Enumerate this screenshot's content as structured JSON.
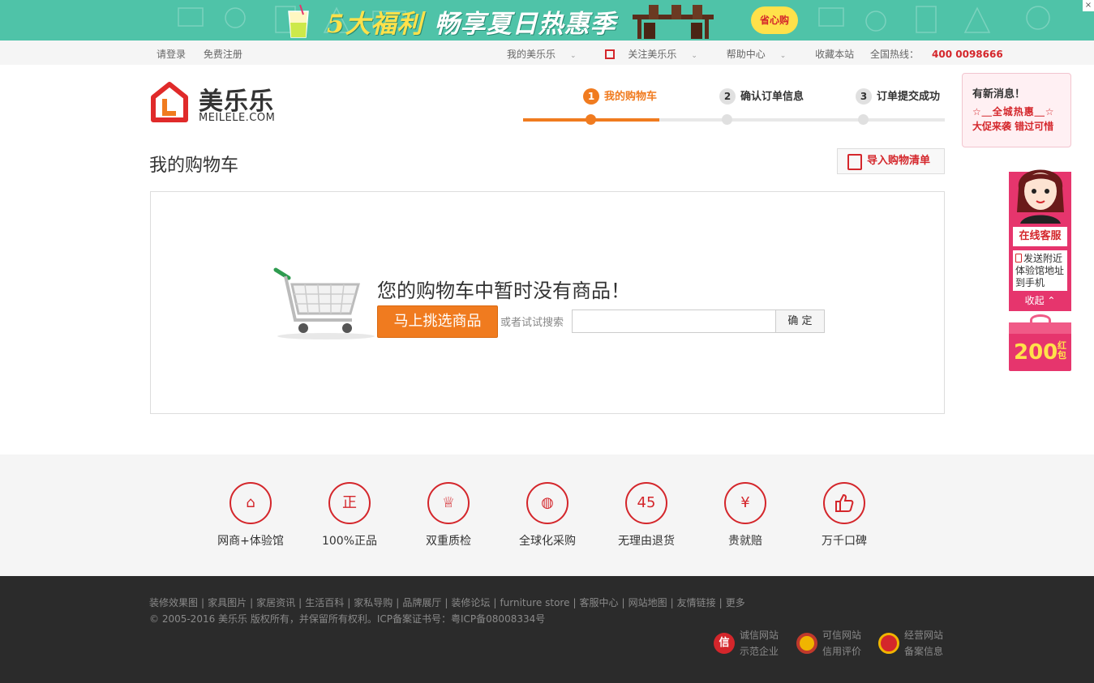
{
  "banner": {
    "title_yellow": "5大福利",
    "title_white": "畅享夏日热惠季",
    "badge": "省心购",
    "close": "×"
  },
  "topnav": {
    "login": "请登录",
    "register": "免费注册",
    "my_account": "我的美乐乐",
    "follow": "关注美乐乐",
    "help": "帮助中心",
    "bookmark": "收藏本站",
    "hotline_label": "全国热线：",
    "hotline_number": "400 0098666"
  },
  "logo": {
    "cn": "美乐乐",
    "en": "MEILELE.COM"
  },
  "steps": [
    {
      "num": "1",
      "label": "我的购物车",
      "active": true
    },
    {
      "num": "2",
      "label": "确认订单信息",
      "active": false
    },
    {
      "num": "3",
      "label": "订单提交成功",
      "active": false
    }
  ],
  "page": {
    "title": "我的购物车",
    "import_label": "导入购物清单"
  },
  "cart": {
    "empty_message": "您的购物车中暂时没有商品！",
    "shop_button": "马上挑选商品",
    "or_search": "或者试试搜索",
    "search_value": "",
    "confirm": "确 定"
  },
  "features": [
    {
      "label": "网商+体验馆",
      "icon": "store-icon",
      "glyph": "⌂"
    },
    {
      "label": "100%正品",
      "icon": "shield-icon",
      "glyph": "正"
    },
    {
      "label": "双重质检",
      "icon": "trophy-icon",
      "glyph": "♕"
    },
    {
      "label": "全球化采购",
      "icon": "globe-icon",
      "glyph": "◍"
    },
    {
      "label": "无理由退货",
      "icon": "return-45-icon",
      "glyph": "45"
    },
    {
      "label": "贵就赔",
      "icon": "yuan-icon",
      "glyph": "¥"
    },
    {
      "label": "万千口碑",
      "icon": "thumbs-up-icon",
      "glyph": "👍"
    }
  ],
  "footer": {
    "links": [
      "装修效果图",
      "家具图片",
      "家居资讯",
      "生活百科",
      "家私导购",
      "品牌展厅",
      "装修论坛",
      "furniture store",
      "客服中心",
      "网站地图",
      "友情链接",
      "更多"
    ],
    "copyright": "© 2005-2016 美乐乐 版权所有，并保留所有权利。ICP备案证书号：粤ICP备08008334号",
    "certs": [
      {
        "line1": "诚信网站",
        "line2": "示范企业",
        "icon": "integrity-icon",
        "color": "#d4262b"
      },
      {
        "line1": "可信网站",
        "line2": "信用评价",
        "icon": "trusted-icon",
        "color": "#c0392b"
      },
      {
        "line1": "经营网站",
        "line2": "备案信息",
        "icon": "business-license-icon",
        "color": "#d4262b"
      }
    ]
  },
  "sidebar": {
    "news_title": "有新消息！",
    "news_line1": "☆＿全城热惠＿☆",
    "news_line2": "大促来袭 错过可惜",
    "online_service": "在线客服",
    "send_address": "发送附近体验馆地址到手机",
    "fold": "收起 ⌃",
    "redpack_amount": "200",
    "redpack_unit": "红包"
  },
  "colors": {
    "accent_orange": "#f07b1f",
    "brand_red": "#d4262b",
    "banner_teal": "#4fc3a8",
    "sidebar_pink": "#e6356d"
  }
}
